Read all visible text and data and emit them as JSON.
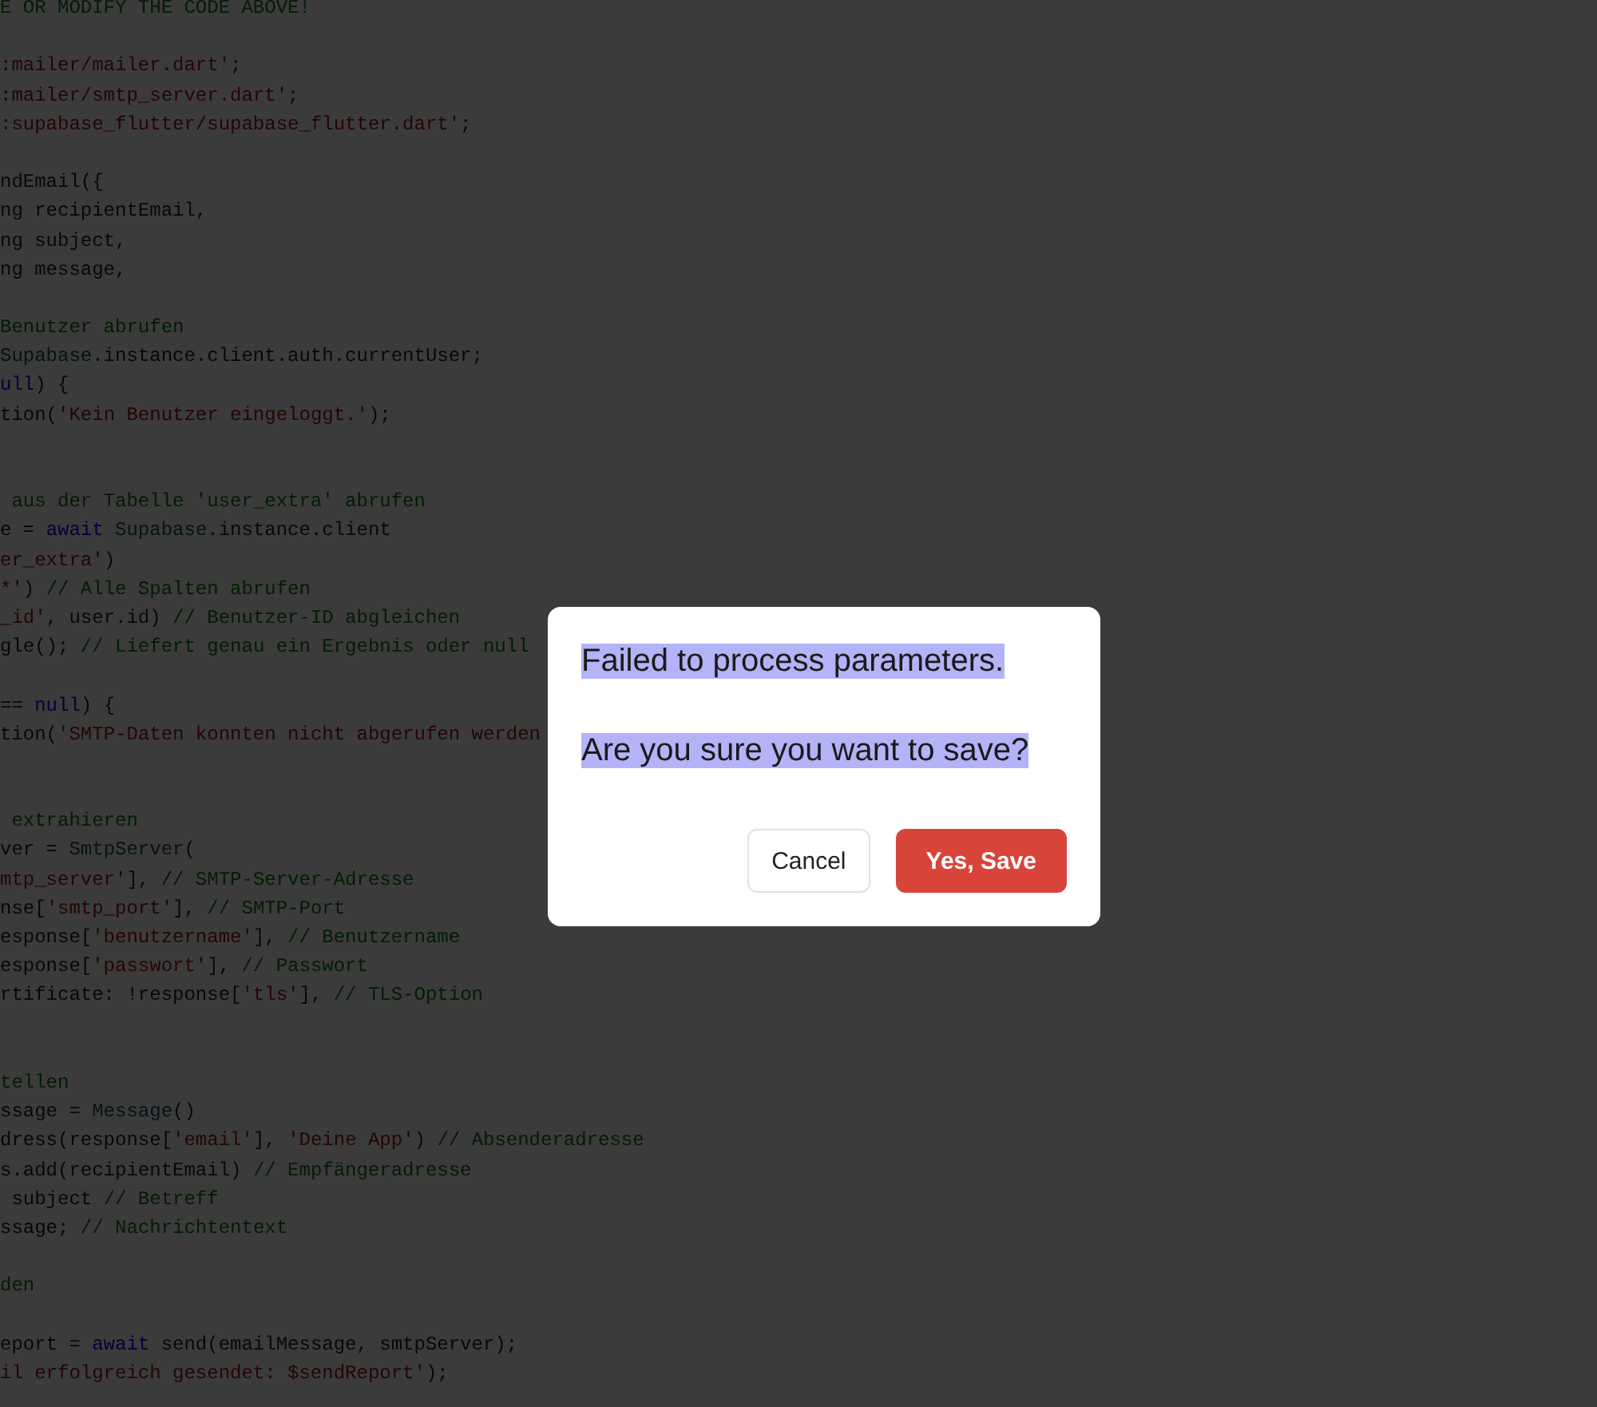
{
  "editor": {
    "lines": [
      {
        "kind": "code",
        "segments": [
          {
            "kind": "comment",
            "text": "E OR MODIFY THE CODE ABOVE!"
          }
        ]
      },
      {
        "kind": "blank"
      },
      {
        "kind": "code",
        "segments": [
          {
            "kind": "string",
            "text": ":mailer/mailer.dart'"
          },
          {
            "kind": "plain",
            "text": ";"
          }
        ]
      },
      {
        "kind": "code",
        "segments": [
          {
            "kind": "string",
            "text": ":mailer/smtp_server.dart'"
          },
          {
            "kind": "plain",
            "text": ";"
          }
        ]
      },
      {
        "kind": "code",
        "segments": [
          {
            "kind": "string",
            "text": ":supabase_flutter/supabase_flutter.dart'"
          },
          {
            "kind": "plain",
            "text": ";"
          }
        ]
      },
      {
        "kind": "blank"
      },
      {
        "kind": "code",
        "segments": [
          {
            "kind": "plain",
            "text": "ndEmail({"
          }
        ]
      },
      {
        "kind": "code",
        "segments": [
          {
            "kind": "plain",
            "text": "ng recipientEmail,"
          }
        ]
      },
      {
        "kind": "code",
        "segments": [
          {
            "kind": "plain",
            "text": "ng subject,"
          }
        ]
      },
      {
        "kind": "code",
        "segments": [
          {
            "kind": "plain",
            "text": "ng message,"
          }
        ]
      },
      {
        "kind": "blank"
      },
      {
        "kind": "code",
        "segments": [
          {
            "kind": "comment",
            "text": "Benutzer abrufen"
          }
        ]
      },
      {
        "kind": "code",
        "segments": [
          {
            "kind": "type",
            "text": "Supabase"
          },
          {
            "kind": "plain",
            "text": ".instance.client.auth.currentUser;"
          }
        ]
      },
      {
        "kind": "code",
        "segments": [
          {
            "kind": "keyword",
            "text": "ull"
          },
          {
            "kind": "plain",
            "text": ") {"
          }
        ]
      },
      {
        "kind": "code",
        "segments": [
          {
            "kind": "plain",
            "text": "tion("
          },
          {
            "kind": "string",
            "text": "'Kein Benutzer eingeloggt.'"
          },
          {
            "kind": "plain",
            "text": ");"
          }
        ]
      },
      {
        "kind": "blank"
      },
      {
        "kind": "blank"
      },
      {
        "kind": "code",
        "segments": [
          {
            "kind": "comment",
            "text": " aus der Tabelle 'user_extra' abrufen"
          }
        ]
      },
      {
        "kind": "code",
        "segments": [
          {
            "kind": "plain",
            "text": "e = "
          },
          {
            "kind": "keyword",
            "text": "await"
          },
          {
            "kind": "type",
            "text": " Supabase"
          },
          {
            "kind": "plain",
            "text": ".instance.client"
          }
        ]
      },
      {
        "kind": "code",
        "segments": [
          {
            "kind": "string",
            "text": "er_extra'"
          },
          {
            "kind": "plain",
            "text": ")"
          }
        ]
      },
      {
        "kind": "code",
        "segments": [
          {
            "kind": "string",
            "text": "*'"
          },
          {
            "kind": "plain",
            "text": ") "
          },
          {
            "kind": "comment",
            "text": "// Alle Spalten abrufen"
          }
        ]
      },
      {
        "kind": "code",
        "segments": [
          {
            "kind": "string",
            "text": "_id'"
          },
          {
            "kind": "plain",
            "text": ", user.id) "
          },
          {
            "kind": "comment",
            "text": "// Benutzer-ID abgleichen"
          }
        ]
      },
      {
        "kind": "code",
        "segments": [
          {
            "kind": "plain",
            "text": "gle(); "
          },
          {
            "kind": "comment",
            "text": "// Liefert genau ein Ergebnis oder null"
          }
        ]
      },
      {
        "kind": "blank"
      },
      {
        "kind": "code",
        "segments": [
          {
            "kind": "plain",
            "text": "== "
          },
          {
            "kind": "keyword",
            "text": "null"
          },
          {
            "kind": "plain",
            "text": ") {"
          }
        ]
      },
      {
        "kind": "code",
        "segments": [
          {
            "kind": "plain",
            "text": "tion("
          },
          {
            "kind": "string",
            "text": "'SMTP-Daten konnten nicht abgerufen werden"
          }
        ]
      },
      {
        "kind": "blank"
      },
      {
        "kind": "blank"
      },
      {
        "kind": "code",
        "segments": [
          {
            "kind": "comment",
            "text": " extrahieren"
          }
        ]
      },
      {
        "kind": "code",
        "segments": [
          {
            "kind": "plain",
            "text": "ver = "
          },
          {
            "kind": "type",
            "text": "SmtpServer"
          },
          {
            "kind": "plain",
            "text": "("
          }
        ]
      },
      {
        "kind": "code",
        "segments": [
          {
            "kind": "string",
            "text": "mtp_server'"
          },
          {
            "kind": "plain",
            "text": "], "
          },
          {
            "kind": "comment",
            "text": "// SMTP-Server-Adresse"
          }
        ]
      },
      {
        "kind": "code",
        "segments": [
          {
            "kind": "plain",
            "text": "nse["
          },
          {
            "kind": "string",
            "text": "'smtp_port'"
          },
          {
            "kind": "plain",
            "text": "], "
          },
          {
            "kind": "comment",
            "text": "// SMTP-Port"
          }
        ]
      },
      {
        "kind": "code",
        "segments": [
          {
            "kind": "plain",
            "text": "esponse["
          },
          {
            "kind": "string",
            "text": "'benutzername'"
          },
          {
            "kind": "plain",
            "text": "], "
          },
          {
            "kind": "comment",
            "text": "// Benutzername"
          }
        ]
      },
      {
        "kind": "code",
        "segments": [
          {
            "kind": "plain",
            "text": "esponse["
          },
          {
            "kind": "string",
            "text": "'passwort'"
          },
          {
            "kind": "plain",
            "text": "], "
          },
          {
            "kind": "comment",
            "text": "// Passwort"
          }
        ]
      },
      {
        "kind": "code",
        "segments": [
          {
            "kind": "plain",
            "text": "rtificate: !response["
          },
          {
            "kind": "string",
            "text": "'tls'"
          },
          {
            "kind": "plain",
            "text": "], "
          },
          {
            "kind": "comment",
            "text": "// TLS-Option"
          }
        ]
      },
      {
        "kind": "blank"
      },
      {
        "kind": "blank"
      },
      {
        "kind": "code",
        "segments": [
          {
            "kind": "comment",
            "text": "tellen"
          }
        ]
      },
      {
        "kind": "code",
        "segments": [
          {
            "kind": "plain",
            "text": "ssage = "
          },
          {
            "kind": "type",
            "text": "Message"
          },
          {
            "kind": "plain",
            "text": "()"
          }
        ]
      },
      {
        "kind": "code",
        "segments": [
          {
            "kind": "plain",
            "text": "dress(response["
          },
          {
            "kind": "string",
            "text": "'email'"
          },
          {
            "kind": "plain",
            "text": "], "
          },
          {
            "kind": "string",
            "text": "'Deine App'"
          },
          {
            "kind": "plain",
            "text": ") "
          },
          {
            "kind": "comment",
            "text": "// Absenderadresse"
          }
        ]
      },
      {
        "kind": "code",
        "segments": [
          {
            "kind": "plain",
            "text": "s.add(recipientEmail) "
          },
          {
            "kind": "comment",
            "text": "// Empfängeradresse"
          }
        ]
      },
      {
        "kind": "code",
        "segments": [
          {
            "kind": "plain",
            "text": " subject "
          },
          {
            "kind": "comment",
            "text": "// Betreff"
          }
        ]
      },
      {
        "kind": "code",
        "segments": [
          {
            "kind": "plain",
            "text": "ssage; "
          },
          {
            "kind": "comment",
            "text": "// Nachrichtentext"
          }
        ]
      },
      {
        "kind": "blank"
      },
      {
        "kind": "code",
        "segments": [
          {
            "kind": "comment",
            "text": "den"
          }
        ]
      },
      {
        "kind": "blank"
      },
      {
        "kind": "code",
        "segments": [
          {
            "kind": "plain",
            "text": "eport = "
          },
          {
            "kind": "keyword",
            "text": "await"
          },
          {
            "kind": "plain",
            "text": " send(emailMessage, smtpServer);"
          }
        ]
      },
      {
        "kind": "code",
        "segments": [
          {
            "kind": "string",
            "text": "il erfolgreich gesendet: $sendReport'"
          },
          {
            "kind": "plain",
            "text": ");"
          }
        ]
      }
    ]
  },
  "dialog": {
    "messages": [
      {
        "text": "Failed to process parameters.",
        "highlighted": true
      },
      {
        "text": "Are you sure you want to save?",
        "highlighted": true
      }
    ],
    "buttons": [
      {
        "kind": "secondary",
        "label": "Cancel"
      },
      {
        "kind": "primary",
        "label": "Yes, Save"
      }
    ]
  }
}
